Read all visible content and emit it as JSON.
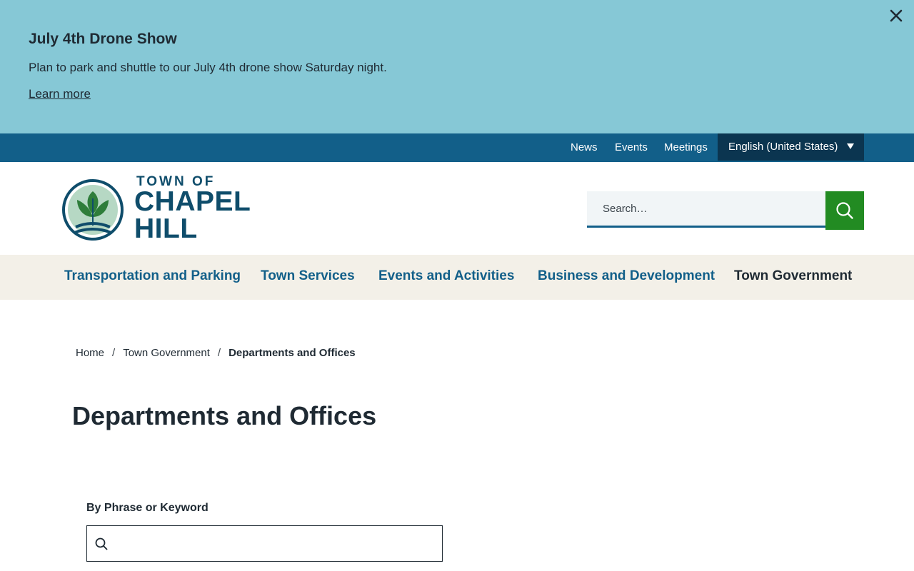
{
  "alert": {
    "title": "July 4th Drone Show",
    "text": "Plan to park and shuttle to our July 4th drone show Saturday night.",
    "link_label": "Learn more",
    "background_color": "#86c8d6",
    "close_icon": "close-icon"
  },
  "utility_nav": {
    "links": [
      "News",
      "Events",
      "Meetings"
    ],
    "language": "English (United States)",
    "bar_color": "#125f89"
  },
  "logo": {
    "line1": "TOWN OF",
    "line2": "CHAPEL",
    "line3": "HILL",
    "icon": "tree-leaf-emblem"
  },
  "search": {
    "placeholder": "Search…",
    "button_icon": "search-icon",
    "button_color": "#228b22"
  },
  "main_nav": {
    "items": [
      "Transportation and Parking",
      "Town Services",
      "Events and Activities",
      "Business and Development",
      "Town Government"
    ],
    "current": "Town Government"
  },
  "breadcrumb": {
    "items": [
      "Home",
      "Town Government",
      "Departments and Offices"
    ],
    "separator": "/"
  },
  "page": {
    "title": "Departments and Offices"
  },
  "filter": {
    "label": "By Phrase or Keyword",
    "value": "",
    "icon": "search-icon"
  }
}
